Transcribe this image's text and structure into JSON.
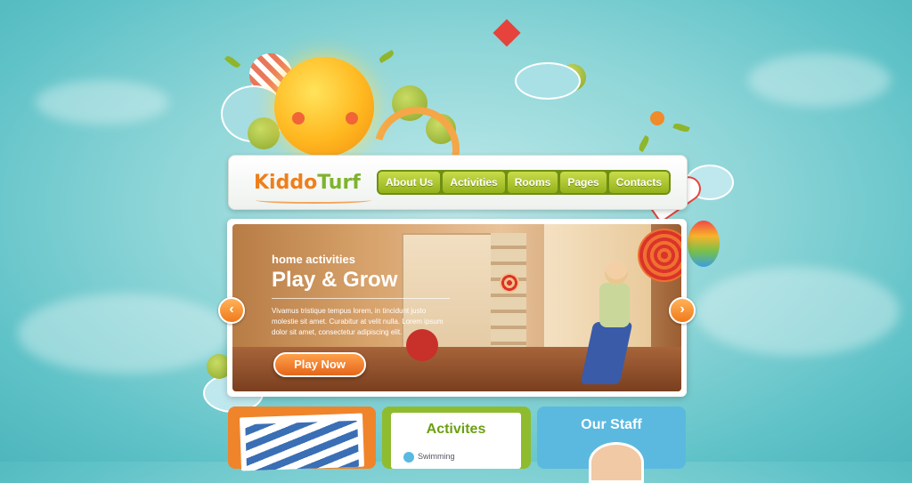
{
  "brand": {
    "logo_part1": "Kiddo",
    "logo_part2": "Turf"
  },
  "nav": {
    "items": [
      "About Us",
      "Activities",
      "Rooms",
      "Pages",
      "Contacts"
    ]
  },
  "slider": {
    "kicker": "home activities",
    "title": "Play & Grow",
    "text": "Vivamus tristique tempus lorem, in tincidunt justo molestie sit amet. Curabitur at velit nulla. Lorem ipsum dolor sit amet, consectetur adipiscing elit.",
    "button_label": "Play Now",
    "prev_glyph": "‹",
    "next_glyph": "›"
  },
  "panels": {
    "activities_title": "Activites",
    "activities_item": "Swimming",
    "staff_title": "Our Staff"
  },
  "colors": {
    "orange": "#f0842b",
    "green": "#8fbc2f",
    "blue": "#5bb9e0",
    "nav_green": "#93b21c"
  }
}
